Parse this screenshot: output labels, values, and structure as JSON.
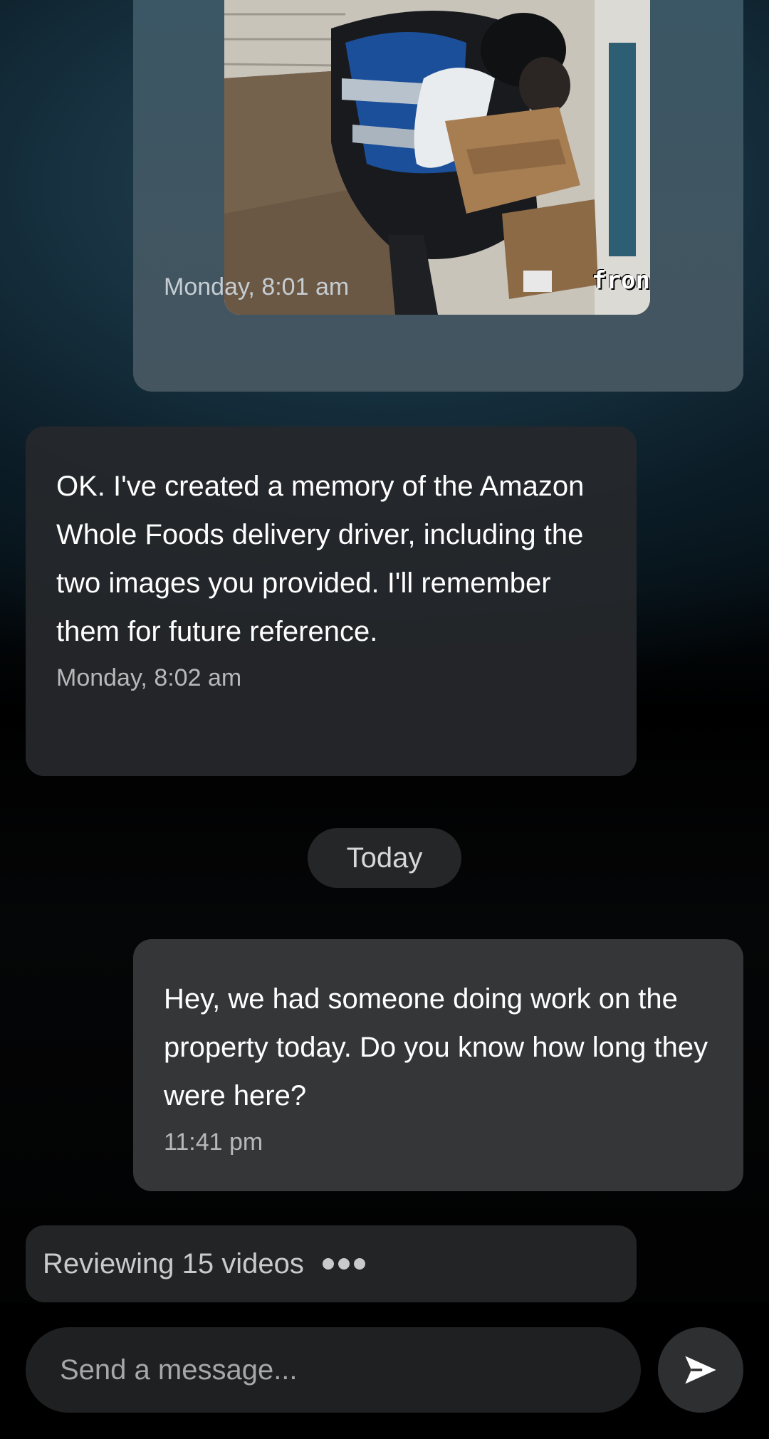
{
  "conversation": {
    "image_message": {
      "stamp_text": "fron",
      "timestamp": "Monday, 8:01 am"
    },
    "assistant_message": {
      "text": "OK. I've created a memory of the Amazon Whole Foods delivery driver, including the two images you provided. I'll remember them for future reference.",
      "timestamp": "Monday, 8:02 am"
    },
    "date_separator": "Today",
    "user_message": {
      "text": "Hey, we had someone doing work on the property today. Do you know how long they were here?",
      "timestamp": "11:41 pm"
    },
    "status": {
      "text": "Reviewing 15 videos"
    }
  },
  "composer": {
    "placeholder": "Send a message...",
    "send_icon": "send-icon"
  },
  "colors": {
    "background_top": "#173140",
    "bubble_outgoing": "#353637",
    "bubble_incoming": "#26282b",
    "image_bubble": "#3a5665"
  }
}
